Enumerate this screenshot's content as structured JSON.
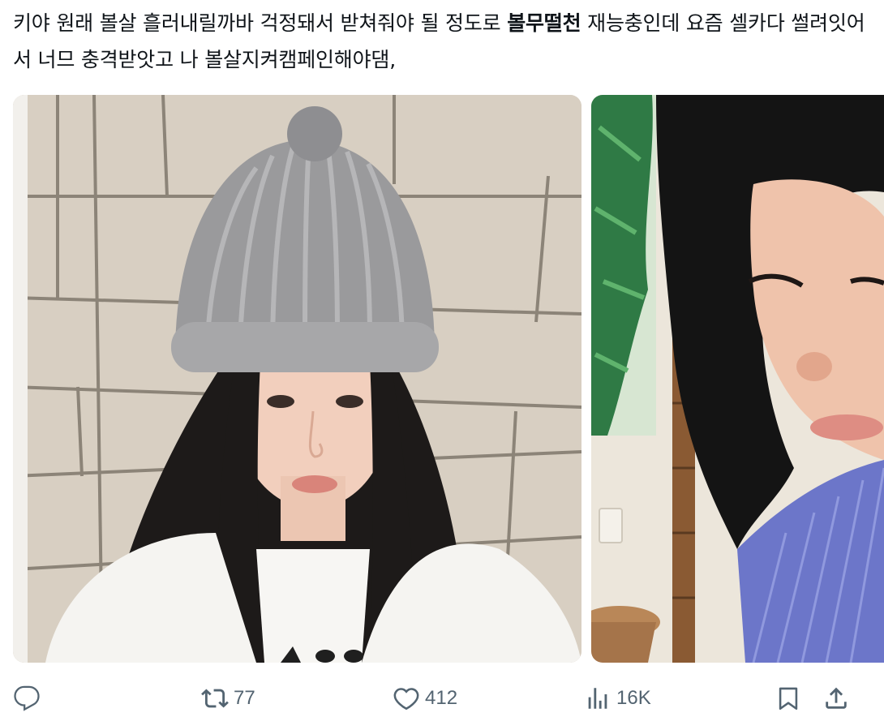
{
  "tweet": {
    "text_before": "키야 원래 볼살 흘러내릴까바 걱정돼서 받쳐줘야 될 정도로 ",
    "text_bold": "볼무떨천",
    "text_after": " 재능충인데 요즘 셀카다 썰려잇어서 너므 충격받앗고 나 볼살지켜캠페인해야댐,"
  },
  "media": {
    "photo_1": "photo-beanie-portrait",
    "photo_2": "photo-side-profile"
  },
  "actions": {
    "reply_icon": "reply-icon",
    "retweet_icon": "retweet-icon",
    "retweet_count": "77",
    "like_icon": "heart-icon",
    "like_count": "412",
    "views_icon": "views-icon",
    "views_count": "16K",
    "bookmark_icon": "bookmark-icon",
    "share_icon": "share-icon"
  },
  "colors": {
    "text": "#0f1419",
    "secondary": "#536471",
    "background": "#ffffff"
  }
}
